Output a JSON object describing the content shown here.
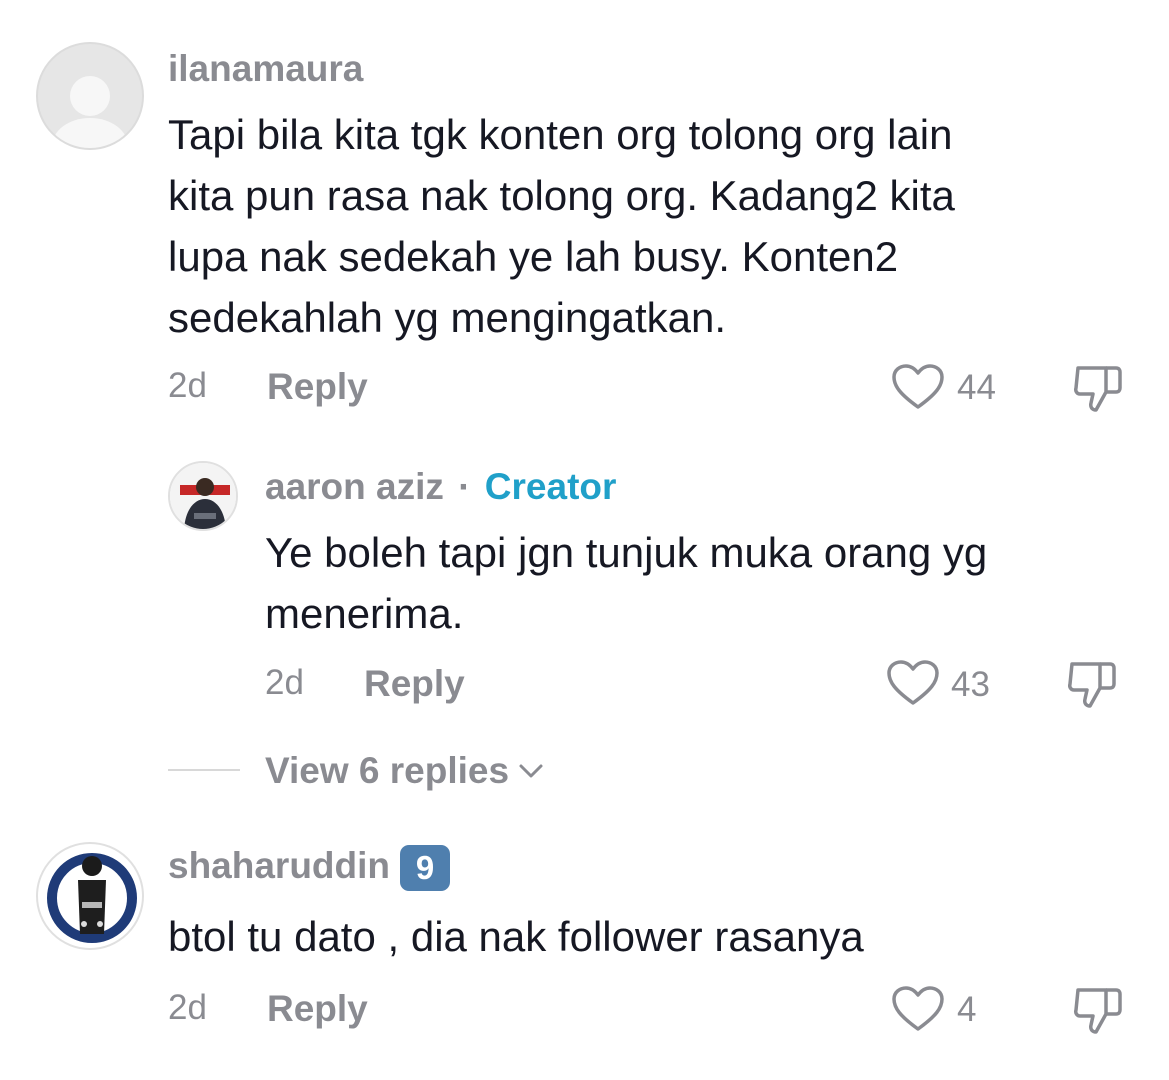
{
  "comments": [
    {
      "username": "ilanamaura",
      "text_lines": [
        "Tapi bila kita tgk konten org tolong org lain",
        "kita pun rasa nak tolong org. Kadang2 kita",
        "lupa nak sedekah ye lah busy. Konten2",
        "sedekahlah yg mengingatkan."
      ],
      "age": "2d",
      "reply_label": "Reply",
      "likes": "44",
      "avatar_icon": "default-avatar-icon",
      "reply": {
        "username": "aaron aziz",
        "separator": "·",
        "role": "Creator",
        "text_lines": [
          "Ye boleh tapi jgn tunjuk muka orang yg",
          "menerima."
        ],
        "age": "2d",
        "reply_label": "Reply",
        "likes": "43"
      },
      "view_replies": "View 6 replies"
    },
    {
      "username": "shaharuddin",
      "badge": "9",
      "text": "btol tu dato , dia nak follower rasanya",
      "age": "2d",
      "reply_label": "Reply",
      "likes": "4"
    }
  ],
  "colors": {
    "text": "#161823",
    "muted": "#8a8b91",
    "creator": "#20a0c9",
    "badge": "#4f7fae",
    "avatar_bg": "#e3e3e3"
  }
}
